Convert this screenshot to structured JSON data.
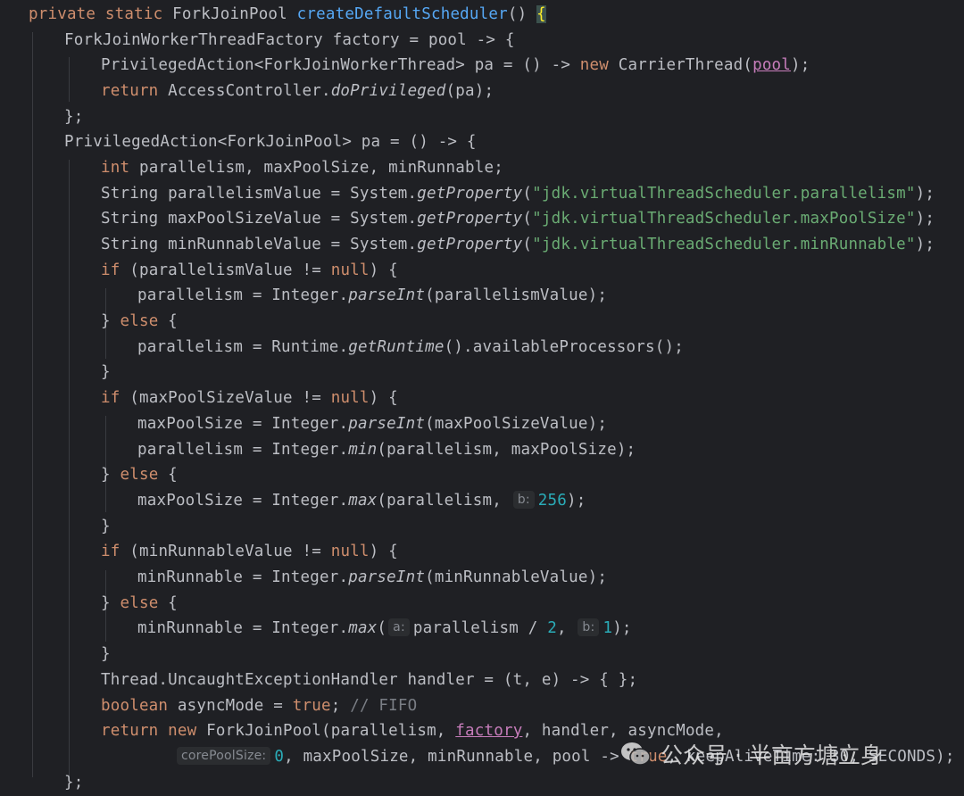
{
  "colors": {
    "background": "#1f2024",
    "keyword": "#cf8e6d",
    "identifier": "#bcbec4",
    "method_decl": "#56a8f5",
    "string": "#6aab73",
    "number": "#2aacb8",
    "field": "#c77dbb",
    "comment": "#7a7e85"
  },
  "code": {
    "l1_private": "private",
    "l1_static": "static",
    "l1_type": "ForkJoinPool",
    "l1_name": "createDefaultScheduler",
    "l1_parens": "()",
    "l1_brace": "{",
    "l2_text": "ForkJoinWorkerThreadFactory factory = pool -> {",
    "l3_a": "PrivilegedAction<ForkJoinWorkerThread> pa = () -> ",
    "l3_new": "new",
    "l3_b": "CarrierThread(",
    "l3_pool": "pool",
    "l3_c": ");",
    "l4_return": "return",
    "l4_a": "AccessController.",
    "l4_m": "doPrivileged",
    "l4_b": "(pa);",
    "l5": "};",
    "l6": "PrivilegedAction<ForkJoinPool> pa = () -> {",
    "l7_int": "int",
    "l7_a": "parallelism, maxPoolSize, minRunnable;",
    "l8_a": "String parallelismValue = System.",
    "l8_m": "getProperty",
    "l8_s": "\"jdk.virtualThreadScheduler.parallelism\"",
    "l9_a": "String maxPoolSizeValue = System.",
    "l9_m": "getProperty",
    "l9_s": "\"jdk.virtualThreadScheduler.maxPoolSize\"",
    "l10_a": "String minRunnableValue = System.",
    "l10_m": "getProperty",
    "l10_s": "\"jdk.virtualThreadScheduler.minRunnable\"",
    "l11_if": "if",
    "l11_a": "(parallelismValue != ",
    "l11_null": "null",
    "l11_b": ") {",
    "l12_a": "parallelism = Integer.",
    "l12_m": "parseInt",
    "l12_b": "(parallelismValue);",
    "l13_a": "} ",
    "l13_else": "else",
    "l13_b": " {",
    "l14_a": "parallelism = Runtime.",
    "l14_m": "getRuntime",
    "l14_b": "().availableProcessors();",
    "l15": "}",
    "l16_if": "if",
    "l16_a": "(maxPoolSizeValue != ",
    "l16_null": "null",
    "l16_b": ") {",
    "l17_a": "maxPoolSize = Integer.",
    "l17_m": "parseInt",
    "l17_b": "(maxPoolSizeValue);",
    "l18_a": "parallelism = Integer.",
    "l18_m": "min",
    "l18_b": "(parallelism, maxPoolSize);",
    "l19_a": "} ",
    "l19_else": "else",
    "l19_b": " {",
    "l20_a": "maxPoolSize = Integer.",
    "l20_m": "max",
    "l20_b": "(parallelism, ",
    "l20_hint": "b:",
    "l20_num": "256",
    "l20_c": ");",
    "l21": "}",
    "l22_if": "if",
    "l22_a": "(minRunnableValue != ",
    "l22_null": "null",
    "l22_b": ") {",
    "l23_a": "minRunnable = Integer.",
    "l23_m": "parseInt",
    "l23_b": "(minRunnableValue);",
    "l24_a": "} ",
    "l24_else": "else",
    "l24_b": " {",
    "l25_a": "minRunnable = Integer.",
    "l25_m": "max",
    "l25_b": "(",
    "l25_hint_a": "a:",
    "l25_c": "parallelism / ",
    "l25_num2": "2",
    "l25_d": ", ",
    "l25_hint_b": "b:",
    "l25_num1": "1",
    "l25_e": ");",
    "l26": "}",
    "l27": "Thread.UncaughtExceptionHandler handler = (t, e) -> { };",
    "l28_bool": "boolean",
    "l28_a": "asyncMode = ",
    "l28_true": "true",
    "l28_b": ";",
    "l28_cm": "// FIFO",
    "l29_return": "return",
    "l29_new": "new",
    "l29_a": "ForkJoinPool(parallelism, ",
    "l29_factory": "factory",
    "l29_b": ", handler, asyncMode,",
    "l30_hint": "corePoolSize:",
    "l30_num": "0",
    "l30_a": ", maxPoolSize, minRunnable, pool -> ",
    "l30_true": "true",
    "l30_b": ", keepAliveTime: 30, SECONDS);",
    "l31": "};"
  },
  "watermark": {
    "text": "公众号 · 半亩方塘立身",
    "icon": "wechat-icon"
  }
}
